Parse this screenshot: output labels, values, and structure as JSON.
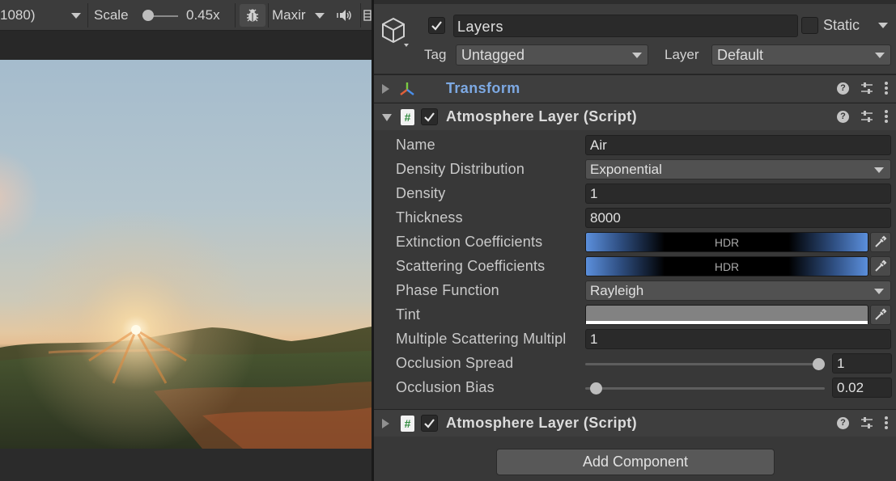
{
  "game_view": {
    "resolution_label": "1080)",
    "scale_label": "Scale",
    "scale_value": "0.45x",
    "maximize_label": "Maxir"
  },
  "inspector": {
    "object_name": "Layers",
    "active": true,
    "static_label": "Static",
    "static_checked": false,
    "tag_label": "Tag",
    "tag_value": "Untagged",
    "layer_label": "Layer",
    "layer_value": "Default",
    "components": [
      {
        "title": "Transform",
        "expanded": false
      },
      {
        "title": "Atmosphere Layer (Script)",
        "expanded": true,
        "enabled": true,
        "properties": {
          "name": {
            "label": "Name",
            "value": "Air"
          },
          "density_distribution": {
            "label": "Density Distribution",
            "value": "Exponential"
          },
          "density": {
            "label": "Density",
            "value": "1"
          },
          "thickness": {
            "label": "Thickness",
            "value": "8000"
          },
          "extinction": {
            "label": "Extinction Coefficients",
            "badge": "HDR"
          },
          "scattering": {
            "label": "Scattering Coefficients",
            "badge": "HDR"
          },
          "phase_function": {
            "label": "Phase Function",
            "value": "Rayleigh"
          },
          "tint": {
            "label": "Tint",
            "color": "#828282"
          },
          "multiple_scattering": {
            "label": "Multiple Scattering Multipl",
            "value": "1"
          },
          "occlusion_spread": {
            "label": "Occlusion Spread",
            "value": "1",
            "slider_fraction": 1.0
          },
          "occlusion_bias": {
            "label": "Occlusion Bias",
            "value": "0.02",
            "slider_fraction": 0.02
          }
        }
      },
      {
        "title": "Atmosphere Layer (Script)",
        "expanded": false,
        "enabled": true
      }
    ],
    "add_component_label": "Add Component"
  },
  "colors": {
    "panel_bg": "#383838",
    "header_bg": "#3e3e3e",
    "transform_title": "#7da9e3",
    "gradient_blue": "#5b8fdc"
  }
}
